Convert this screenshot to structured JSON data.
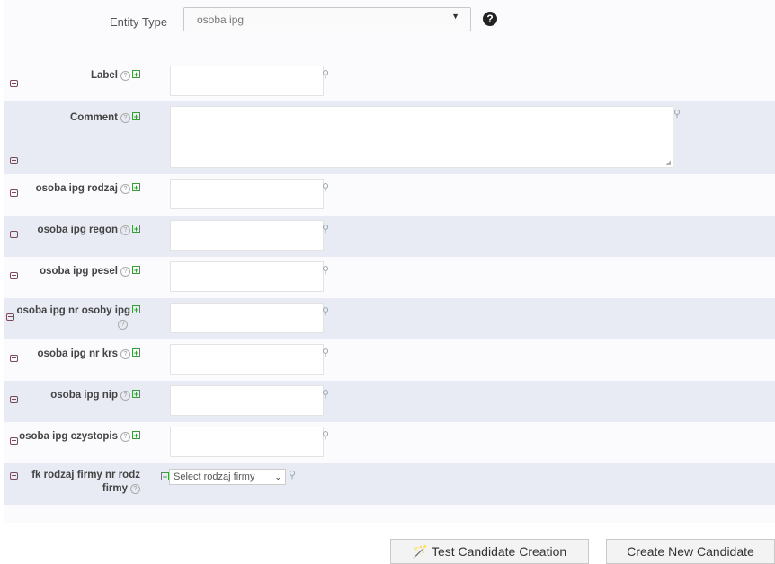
{
  "entity_type": {
    "label": "Entity Type",
    "value": "osoba ipg"
  },
  "fields": [
    {
      "label": "Label"
    },
    {
      "label": "Comment"
    },
    {
      "label": "osoba ipg rodzaj"
    },
    {
      "label": "osoba ipg regon"
    },
    {
      "label": "osoba ipg pesel"
    },
    {
      "label": "osoba ipg nr osoby ipg"
    },
    {
      "label": "osoba ipg nr krs"
    },
    {
      "label": "osoba ipg nip"
    },
    {
      "label": "osoba ipg czystopis"
    },
    {
      "label_line1": "fk rodzaj firmy nr rodz",
      "label_line2": "firmy",
      "select_value": "Select rodzaj firmy"
    }
  ],
  "icons": {
    "help": "question-circle-icon",
    "add": "plus-square-icon",
    "collapse": "minus-square-icon",
    "lang": "gender-language-icon",
    "dropdown": "caret-down-icon"
  },
  "buttons": {
    "test": "Test Candidate Creation",
    "create": "Create New Candidate"
  },
  "colors": {
    "alt_row": "#e8ebf4",
    "add_icon": "#3b9a3b",
    "collapse_icon": "#7a4a5a"
  }
}
